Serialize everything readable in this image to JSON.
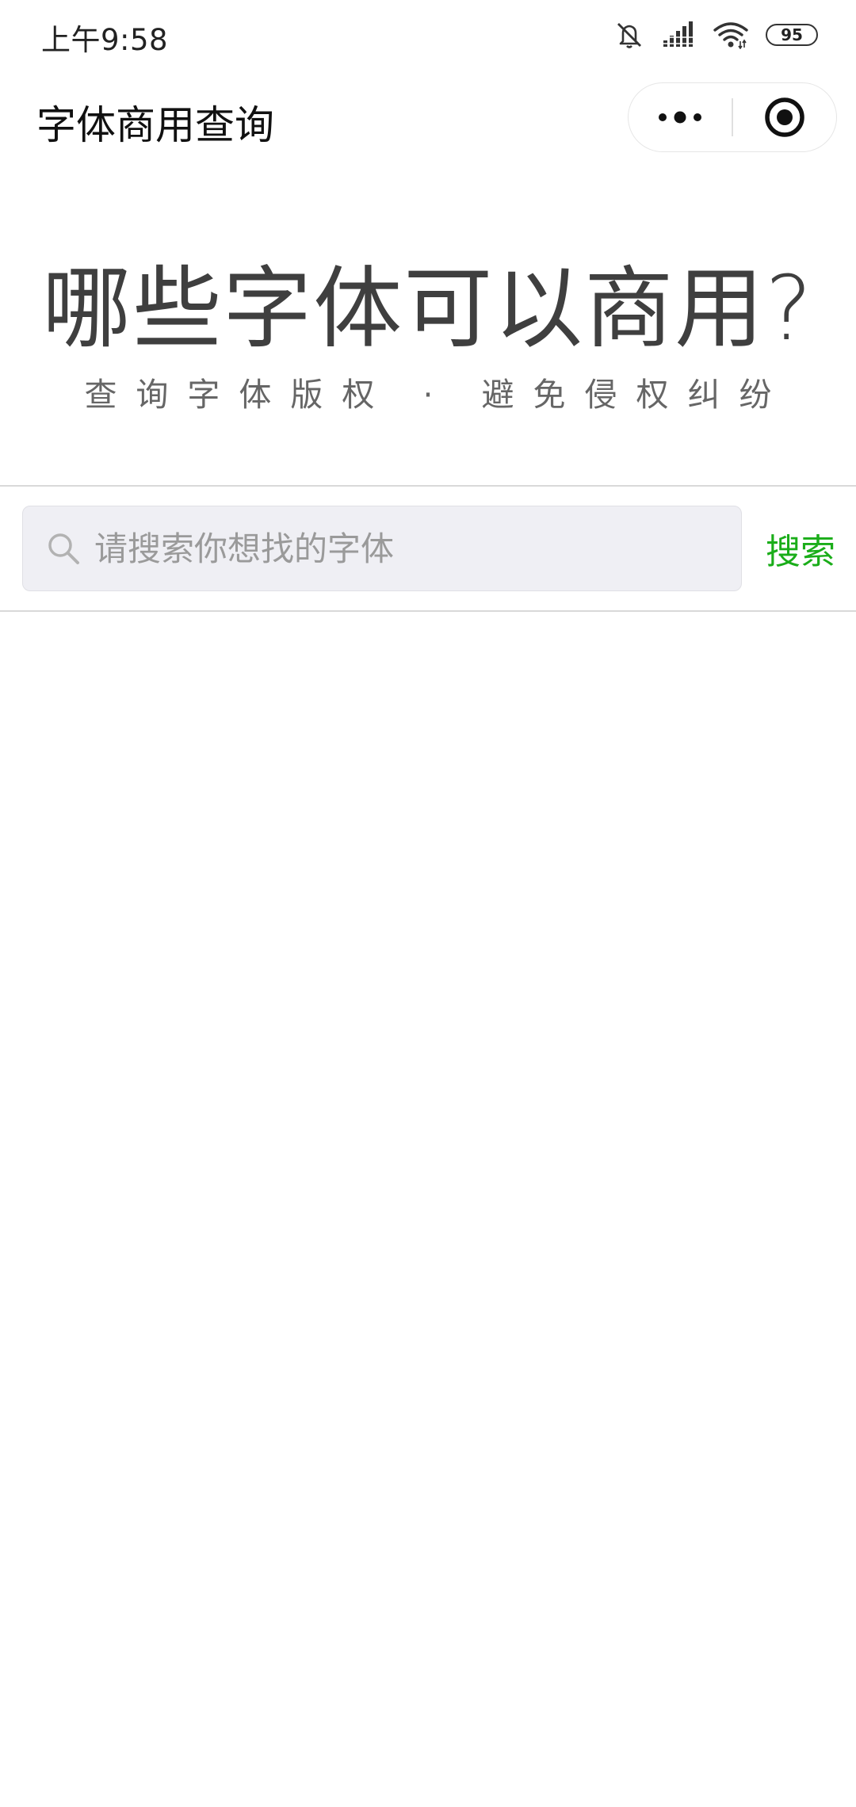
{
  "status_bar": {
    "time": "上午9:58",
    "battery": "95",
    "icons": [
      "mute-icon",
      "signal-icon",
      "wifi-icon",
      "battery-icon"
    ]
  },
  "nav": {
    "title": "字体商用查询",
    "more_icon": "more-dots-icon",
    "close_icon": "target-close-icon"
  },
  "hero": {
    "title": "哪些字体可以商用?",
    "subtitle": "查询字体版权 · 避免侵权纠纷"
  },
  "search": {
    "placeholder": "请搜索你想找的字体",
    "value": "",
    "button_label": "搜索",
    "icon": "search-icon"
  },
  "colors": {
    "accent": "#1aad19",
    "search_bg": "#efeff4",
    "hero_text": "#3f3f3f",
    "divider": "#d9d9d9"
  }
}
